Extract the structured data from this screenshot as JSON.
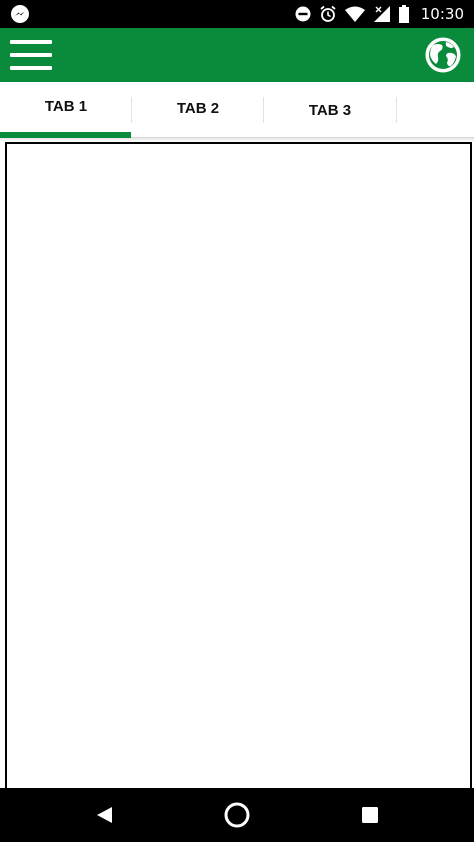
{
  "status_bar": {
    "time": "10:30",
    "icons": [
      "messenger-icon",
      "do-not-disturb-icon",
      "alarm-icon",
      "wifi-icon",
      "cell-signal-icon",
      "battery-icon"
    ]
  },
  "app_bar": {
    "background_color": "#0a8a3b",
    "menu_icon": "hamburger-menu-icon",
    "action_icon": "globe-icon"
  },
  "tabs": [
    {
      "label": "TAB 1",
      "selected": true
    },
    {
      "label": "TAB 2",
      "selected": false
    },
    {
      "label": "TAB 3",
      "selected": false
    }
  ],
  "tab_indicator_color": "#0a8a3b",
  "nav_bar": {
    "buttons": [
      "back-icon",
      "home-icon",
      "recents-icon"
    ]
  }
}
